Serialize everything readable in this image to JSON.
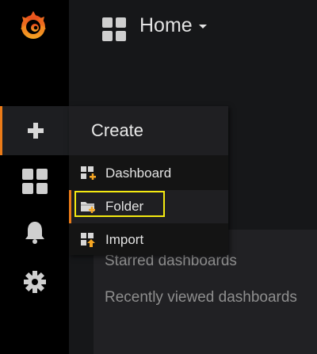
{
  "navbar": {
    "title": "Home"
  },
  "sidemenu": {
    "items": [
      {
        "icon": "grafana-logo-icon"
      },
      {
        "icon": "plus-icon",
        "active": true
      },
      {
        "icon": "dashboards-grid-icon"
      },
      {
        "icon": "bell-icon"
      },
      {
        "icon": "gear-icon"
      }
    ]
  },
  "create_menu": {
    "header": "Create",
    "items": [
      {
        "label": "Dashboard",
        "icon": "dashboard-add-icon"
      },
      {
        "label": "Folder",
        "icon": "folder-add-icon"
      },
      {
        "label": "Import",
        "icon": "import-icon"
      }
    ]
  },
  "content": {
    "starred": "Starred dashboards",
    "recent": "Recently viewed dashboards"
  },
  "colors": {
    "accent": "#eb7b18",
    "highlight": "#f5ea11",
    "background": "#161719",
    "sidemenu": "#000000"
  }
}
